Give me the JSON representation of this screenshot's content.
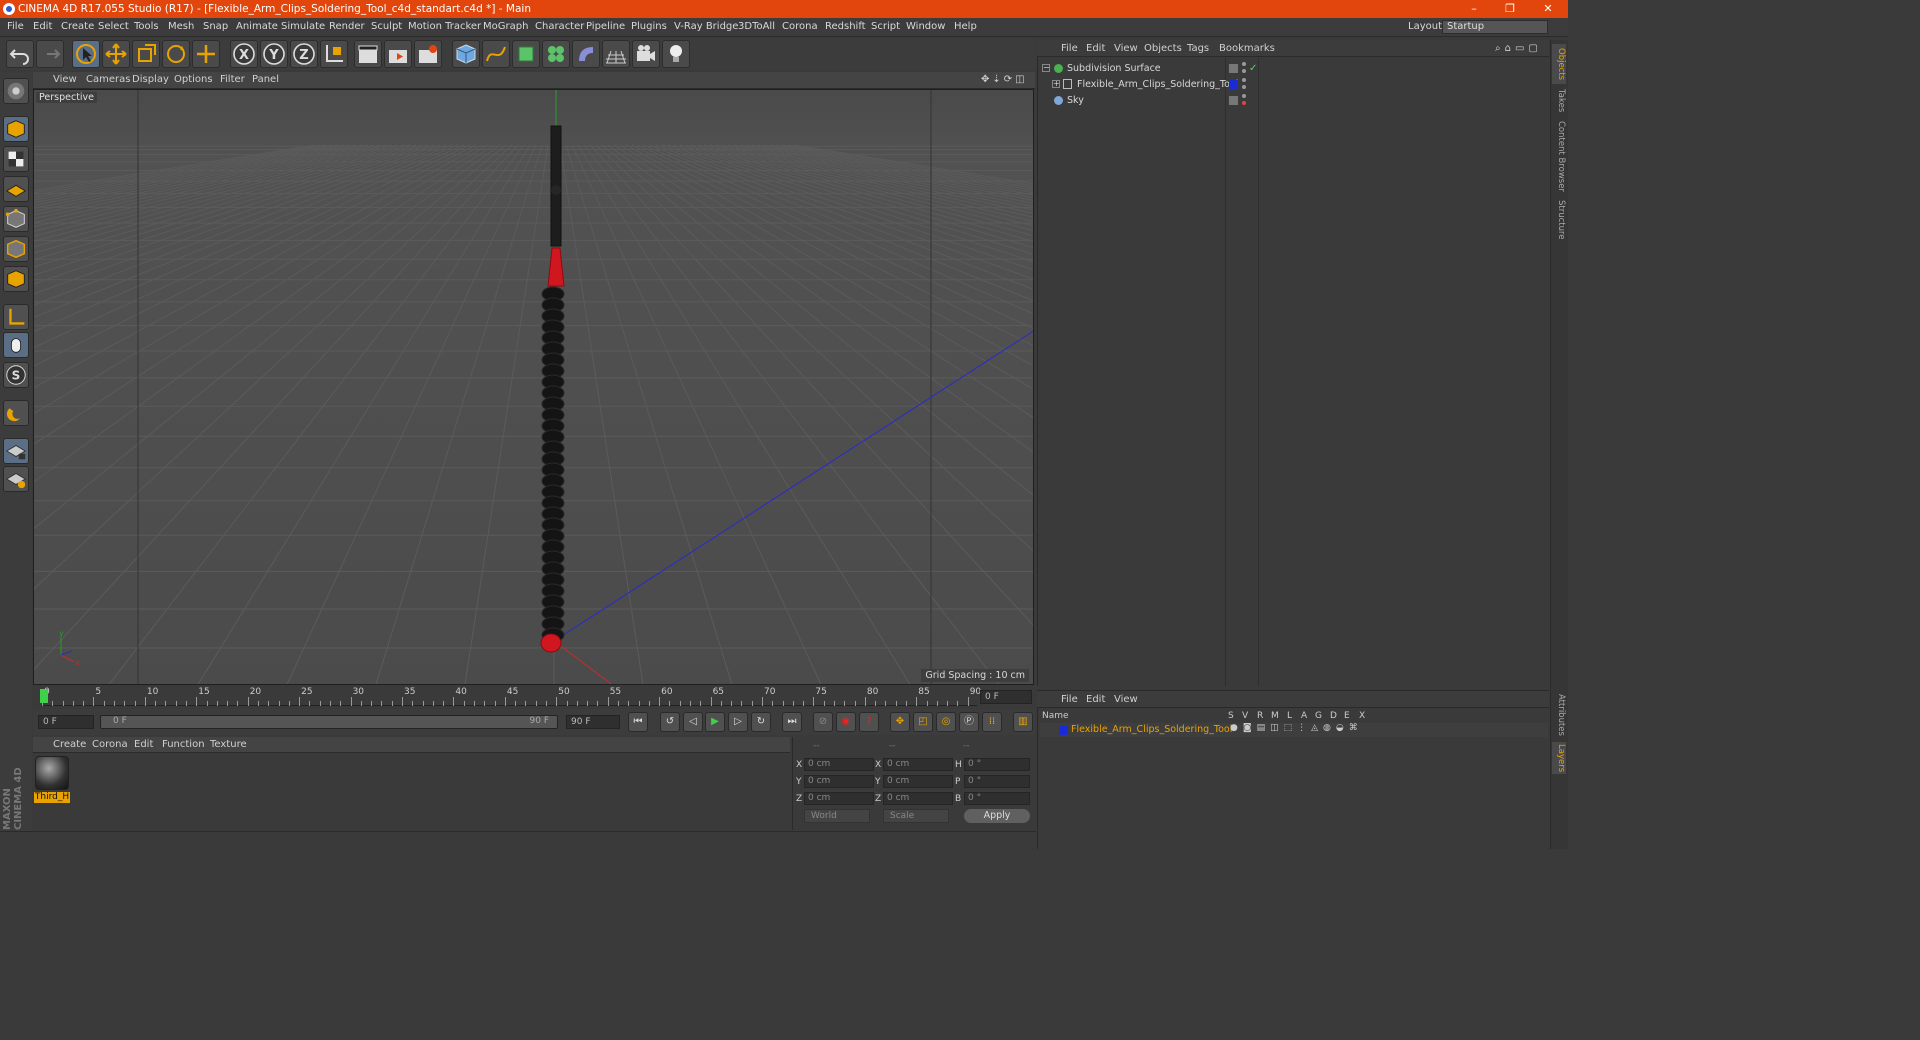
{
  "window": {
    "title": "CINEMA 4D R17.055 Studio (R17) - [Flexible_Arm_Clips_Soldering_Tool_c4d_standart.c4d *] - Main",
    "minimize": "–",
    "restore": "❐",
    "close": "✕"
  },
  "menu": [
    "File",
    "Edit",
    "Create",
    "Select",
    "Tools",
    "Mesh",
    "Snap",
    "Animate",
    "Simulate",
    "Render",
    "Sculpt",
    "Motion Tracker",
    "MoGraph",
    "Character",
    "Pipeline",
    "Plugins",
    "V-Ray Bridge",
    "3DToAll",
    "Corona",
    "Redshift",
    "Script",
    "Window",
    "Help"
  ],
  "layout": {
    "label": "Layout:",
    "value": "Startup"
  },
  "viewport": {
    "menu": [
      "View",
      "Cameras",
      "Display",
      "Options",
      "Filter",
      "Panel"
    ],
    "camera_label": "Perspective",
    "grid_spacing": "Grid Spacing : 10 cm"
  },
  "timeline": {
    "ticks": [
      "0",
      "5",
      "10",
      "15",
      "20",
      "25",
      "30",
      "35",
      "40",
      "45",
      "50",
      "55",
      "60",
      "65",
      "70",
      "75",
      "80",
      "85",
      "90"
    ],
    "current_frame": "0 F",
    "start_field": "0 F",
    "slider_start": "0 F",
    "slider_end": "90 F",
    "end_field": "90 F"
  },
  "material_manager": {
    "menu": [
      "Create",
      "Corona",
      "Edit",
      "Function",
      "Texture"
    ],
    "material_name": "Third_H"
  },
  "coordinates": {
    "header": [
      "--",
      "--",
      "--"
    ],
    "rows": [
      {
        "a": "X",
        "av": "0 cm",
        "b": "X",
        "bv": "0 cm",
        "c": "H",
        "cv": "0 °"
      },
      {
        "a": "Y",
        "av": "0 cm",
        "b": "Y",
        "bv": "0 cm",
        "c": "P",
        "cv": "0 °"
      },
      {
        "a": "Z",
        "av": "0 cm",
        "b": "Z",
        "bv": "0 cm",
        "c": "B",
        "cv": "0 °"
      }
    ],
    "mode": "World",
    "type": "Scale",
    "apply": "Apply"
  },
  "object_manager": {
    "menu": [
      "File",
      "Edit",
      "View",
      "Objects",
      "Tags",
      "Bookmarks"
    ],
    "objects": [
      {
        "name": "Subdivision Surface",
        "color": "#4caf50"
      },
      {
        "name": "Flexible_Arm_Clips_Soldering_Tool",
        "color": "#1a2bd6"
      },
      {
        "name": "Sky",
        "color": "#7fa8d8"
      }
    ]
  },
  "layer_manager": {
    "menu": [
      "File",
      "Edit",
      "View"
    ],
    "columns": [
      "Name",
      "S",
      "V",
      "R",
      "M",
      "L",
      "A",
      "G",
      "D",
      "E",
      "X"
    ],
    "layer_name": "Flexible_Arm_Clips_Soldering_Tool",
    "layer_color": "#1a2bd6"
  },
  "right_tabs": [
    "Objects",
    "Takes",
    "Content Browser",
    "Structure",
    "Attributes",
    "Layers"
  ],
  "brand": "MAXON CINEMA 4D",
  "colors": {
    "title_bar": "#e2460c",
    "accent": "#e9a300",
    "model_red": "#d0161f"
  }
}
